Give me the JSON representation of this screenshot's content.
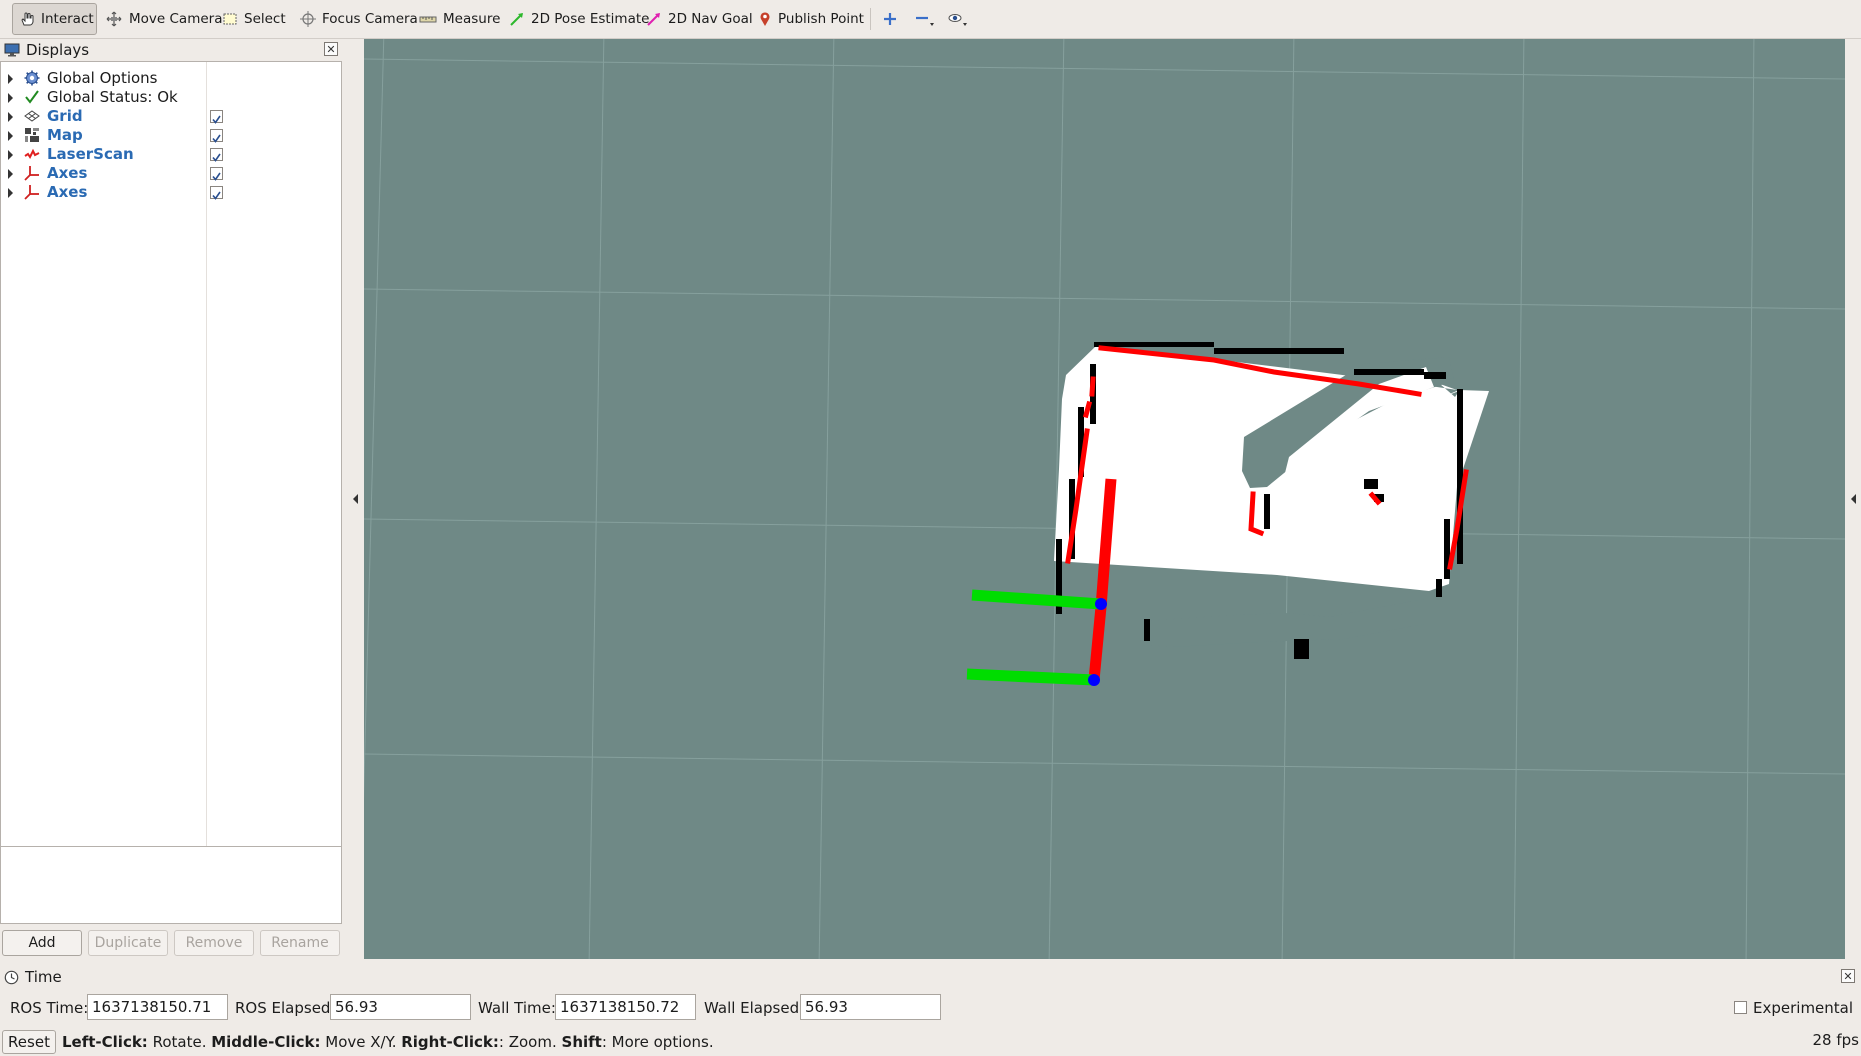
{
  "toolbar": {
    "tools": [
      {
        "label": "Interact",
        "icon": "hand-icon"
      },
      {
        "label": "Move Camera",
        "icon": "move-camera-icon"
      },
      {
        "label": "Select",
        "icon": "select-icon"
      },
      {
        "label": "Focus Camera",
        "icon": "focus-camera-icon"
      },
      {
        "label": "Measure",
        "icon": "ruler-icon"
      },
      {
        "label": "2D Pose Estimate",
        "icon": "green-arrow-icon"
      },
      {
        "label": "2D Nav Goal",
        "icon": "magenta-arrow-icon"
      },
      {
        "label": "Publish Point",
        "icon": "map-pin-icon"
      }
    ],
    "active_tool": "Interact"
  },
  "displays": {
    "title": "Displays",
    "items": [
      {
        "label": "Global Options",
        "icon": "gear-icon",
        "checked": null,
        "style": "normal"
      },
      {
        "label": "Global Status: Ok",
        "icon": "checkmark-icon",
        "checked": null,
        "style": "normal"
      },
      {
        "label": "Grid",
        "icon": "grid-icon",
        "checked": true,
        "style": "blue"
      },
      {
        "label": "Map",
        "icon": "map-icon",
        "checked": true,
        "style": "blue"
      },
      {
        "label": "LaserScan",
        "icon": "laserscan-icon",
        "checked": true,
        "style": "blue"
      },
      {
        "label": "Axes",
        "icon": "axes-icon",
        "checked": true,
        "style": "blue"
      },
      {
        "label": "Axes",
        "icon": "axes-icon",
        "checked": true,
        "style": "blue"
      }
    ],
    "buttons": {
      "add": "Add",
      "duplicate": "Duplicate",
      "remove": "Remove",
      "rename": "Rename"
    }
  },
  "time": {
    "title": "Time",
    "ros_time_label": "ROS Time:",
    "ros_time_value": "1637138150.71",
    "ros_elapsed_label": "ROS Elapsed:",
    "ros_elapsed_value": "56.93",
    "wall_time_label": "Wall Time:",
    "wall_time_value": "1637138150.72",
    "wall_elapsed_label": "Wall Elapsed:",
    "wall_elapsed_value": "56.93",
    "experimental_label": "Experimental",
    "experimental_checked": false
  },
  "status": {
    "reset_label": "Reset",
    "left_click": "Left-Click:",
    "left_click_desc": " Rotate. ",
    "middle_click": "Middle-Click:",
    "middle_click_desc": " Move X/Y. ",
    "right_click": "Right-Click:",
    "right_click_desc": ": Zoom. ",
    "shift": "Shift",
    "shift_desc": ": More options.",
    "fps": "28 fps"
  },
  "colors": {
    "viewport_bg": "#6f8986",
    "grid_line": "#86a09d",
    "map_free": "#ffffff",
    "map_wall": "#000000",
    "map_unknown": "#6f8986",
    "laser": "#ff0000",
    "axis_x": "#ff0000",
    "axis_y": "#00dd00",
    "axis_z": "#0000ff",
    "display_label_blue": "#2a6ab3"
  }
}
